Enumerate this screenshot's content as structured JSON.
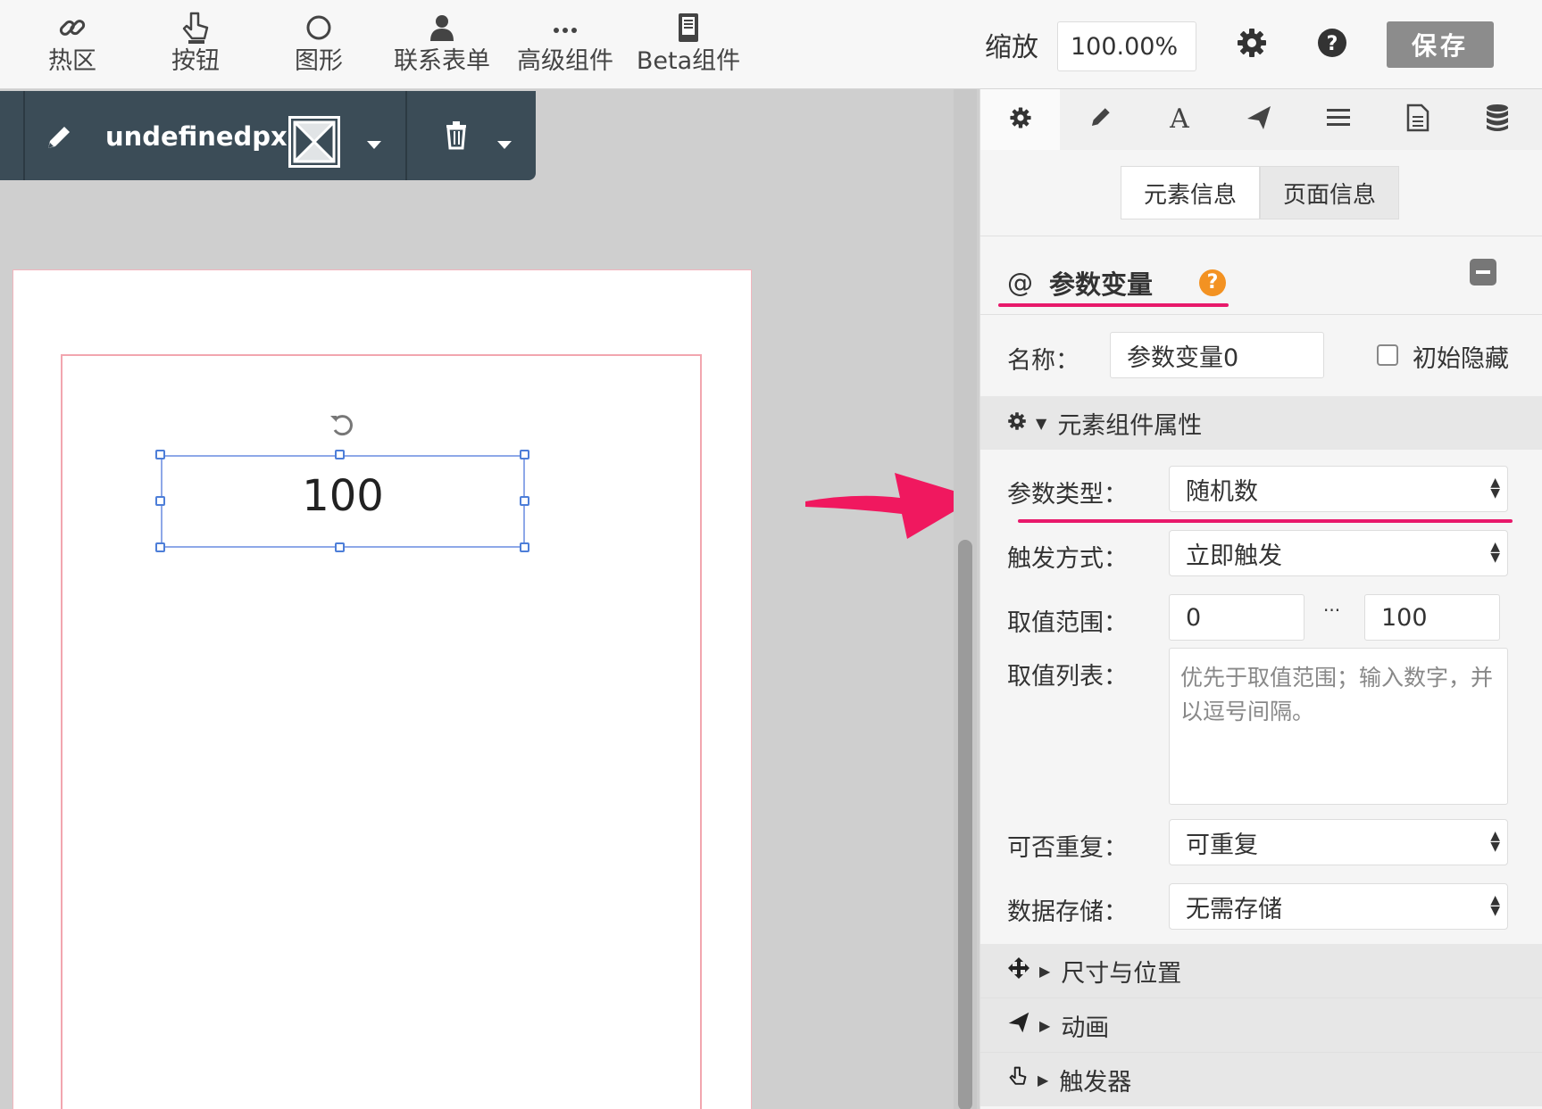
{
  "toolbar": {
    "tools": [
      {
        "label": "热区",
        "icon": "link-icon"
      },
      {
        "label": "按钮",
        "icon": "pointer-icon"
      },
      {
        "label": "图形",
        "icon": "circle-icon"
      },
      {
        "label": "联系表单",
        "icon": "user-icon"
      },
      {
        "label": "高级组件",
        "icon": "more-icon"
      },
      {
        "label": "Beta组件",
        "icon": "tablet-icon"
      }
    ],
    "zoom_label": "缩放",
    "zoom_value": "100.00%",
    "save_label": "保存"
  },
  "float_toolbar": {
    "size_text": "undefinedpx"
  },
  "canvas": {
    "element_text": "100"
  },
  "panel": {
    "tabs": [
      "gear-icon",
      "pencil-icon",
      "font-icon",
      "send-icon",
      "list-icon",
      "document-icon",
      "database-icon"
    ],
    "segments": [
      "元素信息",
      "页面信息"
    ],
    "section_prefix": "@",
    "section_title": "参数变量",
    "help": "?",
    "name_label": "名称：",
    "name_value": "参数变量0",
    "hidden_label": "初始隐藏",
    "component_props": "元素组件属性",
    "param_type_label": "参数类型：",
    "param_type_value": "随机数",
    "trigger_label": "触发方式：",
    "trigger_value": "立即触发",
    "range_label": "取值范围：",
    "range_min": "0",
    "range_sep": "···",
    "range_max": "100",
    "list_label": "取值列表：",
    "list_placeholder": "优先于取值范围；输入数字，并以逗号间隔。",
    "repeat_label": "可否重复：",
    "repeat_value": "可重复",
    "storage_label": "数据存储：",
    "storage_value": "无需存储",
    "groups": [
      "尺寸与位置",
      "动画",
      "触发器"
    ]
  },
  "colors": {
    "accent_pink": "#e8196b",
    "help_orange": "#f39222",
    "float_bar": "#3b4c57",
    "save_button": "#8c8c8c"
  }
}
